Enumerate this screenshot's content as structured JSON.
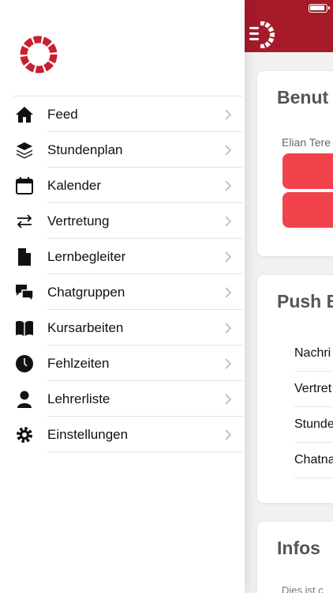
{
  "drawer": {
    "items": [
      {
        "label": "Feed",
        "icon": "home-icon"
      },
      {
        "label": "Stundenplan",
        "icon": "layers-icon"
      },
      {
        "label": "Kalender",
        "icon": "calendar-icon"
      },
      {
        "label": "Vertretung",
        "icon": "swap-arrows-icon"
      },
      {
        "label": "Lernbegleiter",
        "icon": "document-icon"
      },
      {
        "label": "Chatgruppen",
        "icon": "chat-bubbles-icon"
      },
      {
        "label": "Kursarbeiten",
        "icon": "book-icon"
      },
      {
        "label": "Fehlzeiten",
        "icon": "clock-icon"
      },
      {
        "label": "Lehrerliste",
        "icon": "person-icon"
      },
      {
        "label": "Einstellungen",
        "icon": "gear-icon"
      }
    ]
  },
  "main": {
    "user_card": {
      "title": "Benut",
      "user_name": "Elian Tere"
    },
    "push_card": {
      "title": "Push B",
      "rows": [
        "Nachri",
        "Vertret",
        "Stunde",
        "Chatna"
      ]
    },
    "info_card": {
      "title": "Infos",
      "text": "Dies ist c"
    }
  },
  "colors": {
    "brand": "#a61a2a",
    "accent": "#f0434b",
    "logo": "#c8202f"
  }
}
